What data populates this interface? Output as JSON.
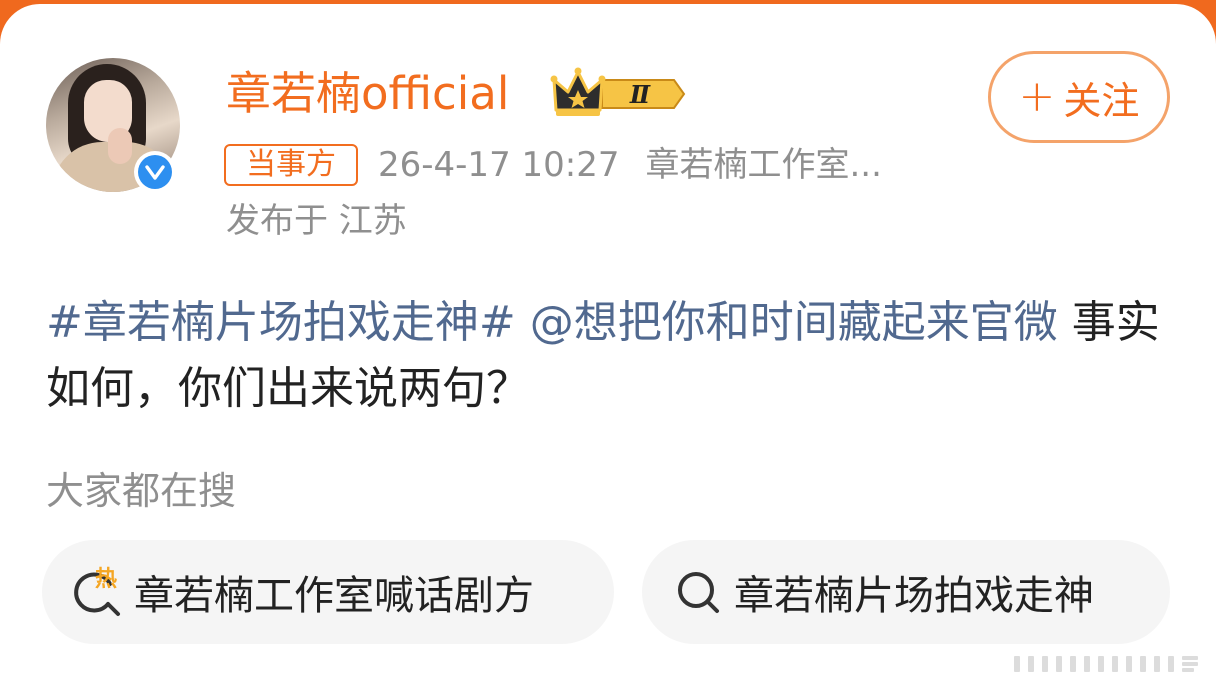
{
  "post": {
    "author": {
      "name": "章若楠official",
      "badge_level": "Ⅱ"
    },
    "follow_label": "关注",
    "party_tag": "当事方",
    "timestamp": "26-4-17 10:27",
    "source": "章若楠工作室...",
    "location": "发布于 江苏",
    "text": {
      "hashtag": "#章若楠片场拍戏走神#",
      "mention": "@想把你和时间藏起来官微",
      "body": "事实如何，你们出来说两句？"
    }
  },
  "search": {
    "heading": "大家都在搜",
    "chips": [
      {
        "label": "章若楠工作室喊话剧方",
        "icon": "hot-search-icon",
        "icon_text": "热"
      },
      {
        "label": "章若楠片场拍戏走神",
        "icon": "search-icon"
      }
    ]
  },
  "colors": {
    "accent": "#f26d1f",
    "link": "#51698f",
    "muted": "#8f8f8f",
    "verified": "#2d8ff0",
    "chip_bg": "#f5f5f5"
  }
}
